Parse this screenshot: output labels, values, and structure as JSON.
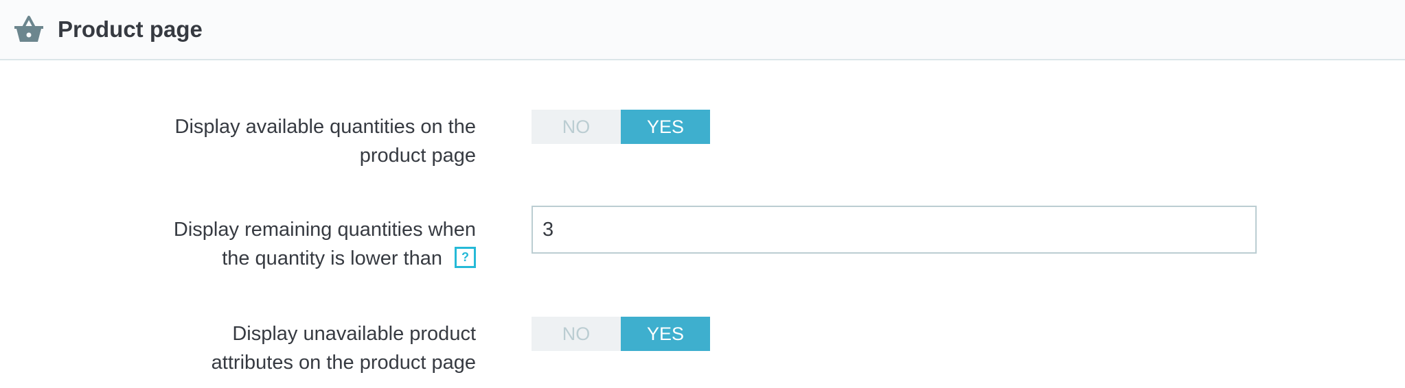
{
  "header": {
    "title": "Product page",
    "icon": "basket-icon"
  },
  "rows": [
    {
      "label_line1": "Display available quantities on the",
      "label_line2": "product page",
      "control": "switch",
      "no_label": "NO",
      "yes_label": "YES",
      "selected": "YES"
    },
    {
      "label_line1": "Display remaining quantities when",
      "label_line2": "the quantity is lower than",
      "help_icon": "?",
      "control": "text",
      "value": "3"
    },
    {
      "label_line1": "Display unavailable product",
      "label_line2": "attributes on the product page",
      "control": "switch",
      "no_label": "NO",
      "yes_label": "YES",
      "selected": "YES"
    }
  ],
  "colors": {
    "accent": "#3eafce",
    "help": "#25b9d7",
    "text": "#363a41",
    "off_bg": "#eef1f3",
    "off_text": "#bbcdd2"
  }
}
